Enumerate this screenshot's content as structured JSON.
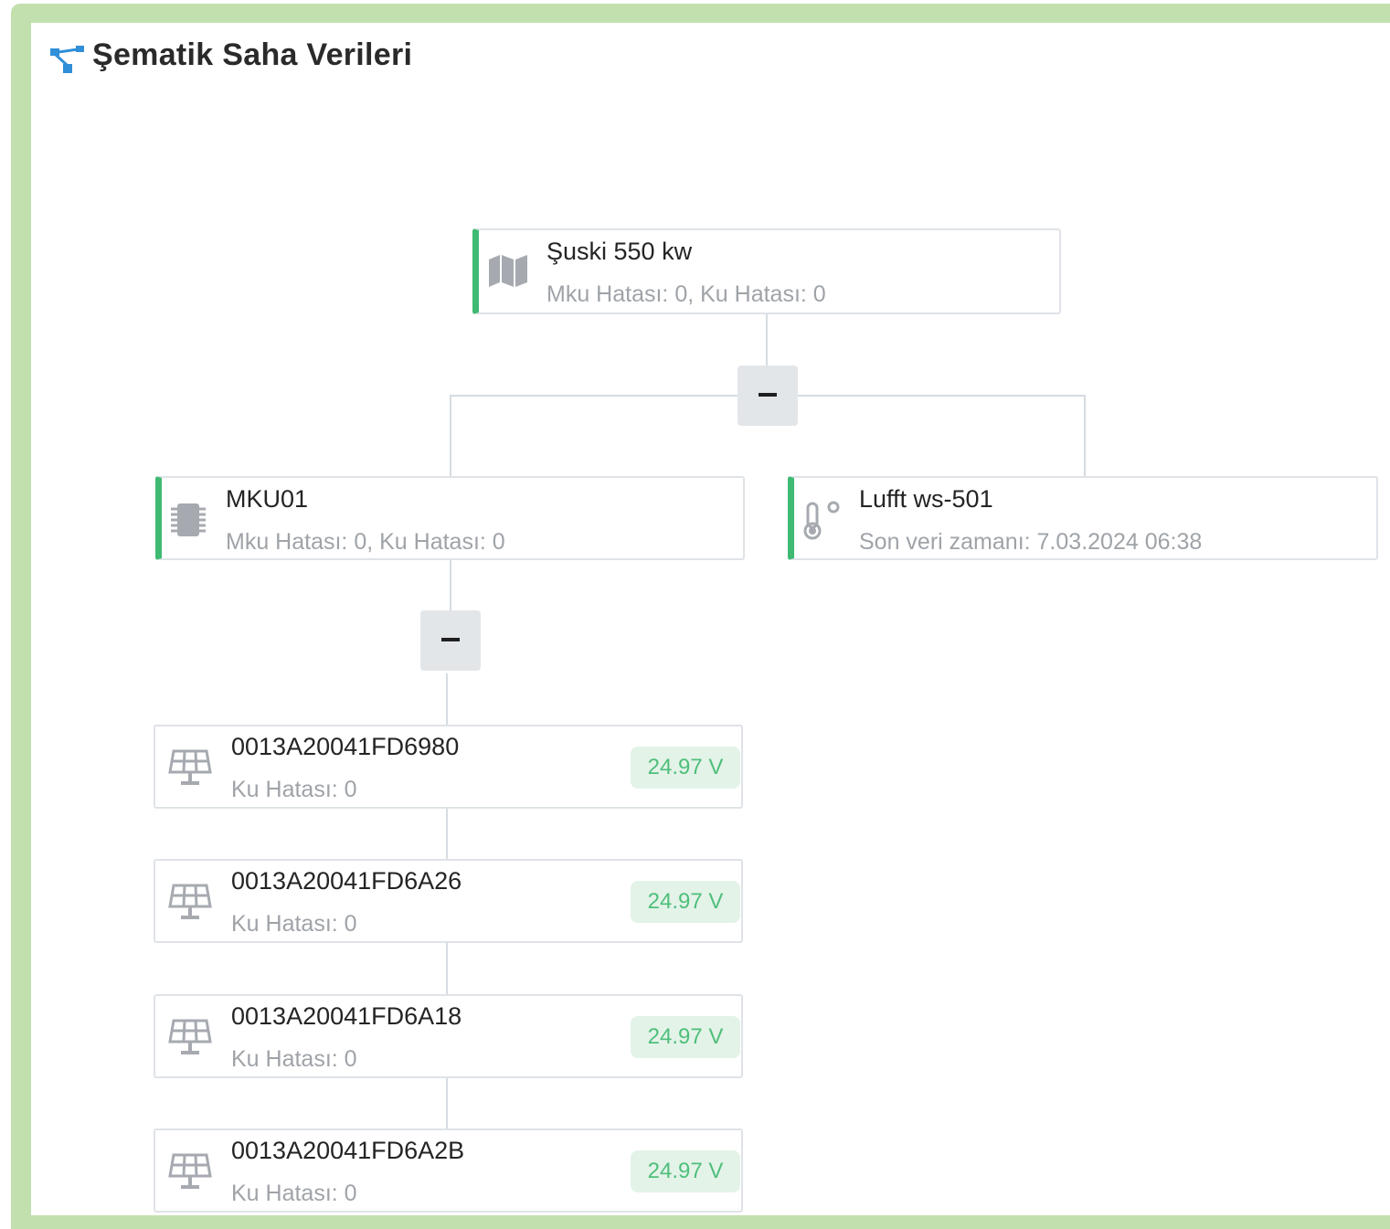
{
  "header": {
    "title": "Şematik Saha Verileri",
    "icon": "sitemap-icon"
  },
  "colors": {
    "frame": "#c1e0ae",
    "accent": "#3fba73",
    "badge_bg": "#e3f3e8",
    "badge_text": "#4fbf7b",
    "icon": "#a6aab0",
    "title_icon": "#2f8fd8"
  },
  "tree": {
    "root": {
      "title": "Şuski 550 kw",
      "subtitle": "Mku Hatası: 0, Ku Hatası: 0",
      "icon": "map-icon",
      "toggle": "−"
    },
    "mku": {
      "title": "MKU01",
      "subtitle": "Mku Hatası: 0, Ku Hatası: 0",
      "icon": "chip-icon",
      "toggle": "−"
    },
    "station": {
      "title": "Lufft ws-501",
      "subtitle": "Son veri zamanı: 7.03.2024 06:38",
      "icon": "thermometer-icon"
    },
    "panels": [
      {
        "id": "0013A20041FD6980",
        "subtitle": "Ku Hatası: 0",
        "voltage": "24.97 V",
        "icon": "solar-panel-icon"
      },
      {
        "id": "0013A20041FD6A26",
        "subtitle": "Ku Hatası: 0",
        "voltage": "24.97 V",
        "icon": "solar-panel-icon"
      },
      {
        "id": "0013A20041FD6A18",
        "subtitle": "Ku Hatası: 0",
        "voltage": "24.97 V",
        "icon": "solar-panel-icon"
      },
      {
        "id": "0013A20041FD6A2B",
        "subtitle": "Ku Hatası: 0",
        "voltage": "24.97 V",
        "icon": "solar-panel-icon"
      }
    ]
  }
}
